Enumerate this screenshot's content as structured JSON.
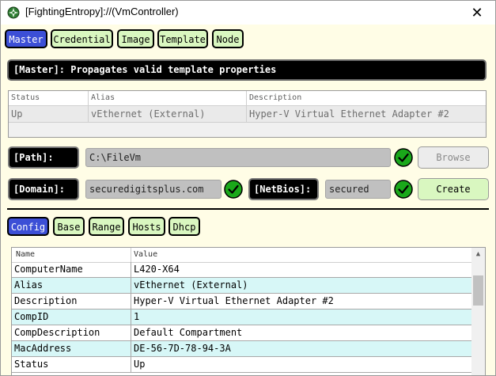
{
  "window": {
    "title": "[FightingEntropy]://(VmController)",
    "close_glyph": "✕",
    "icon": "globe-icon"
  },
  "main_tabs": [
    {
      "label": "Master",
      "active": true
    },
    {
      "label": "Credential",
      "active": false
    },
    {
      "label": "Image",
      "active": false
    },
    {
      "label": "Template",
      "active": false
    },
    {
      "label": "Node",
      "active": false
    }
  ],
  "banner": {
    "text": "[Master]: Propagates valid template properties"
  },
  "adapter_grid": {
    "columns": [
      "Status",
      "Alias",
      "Description"
    ],
    "rows": [
      [
        "Up",
        "vEthernet (External)",
        "Hyper-V Virtual Ethernet Adapter #2"
      ]
    ]
  },
  "path": {
    "label": "[Path]:",
    "value": "C:\\FileVm",
    "browse_label": "Browse"
  },
  "domain": {
    "label": "[Domain]:",
    "value": "securedigitsplus.com"
  },
  "netbios": {
    "label": "[NetBios]:",
    "value": "secured",
    "create_label": "Create"
  },
  "sub_tabs": [
    {
      "label": "Config",
      "active": true
    },
    {
      "label": "Base",
      "active": false
    },
    {
      "label": "Range",
      "active": false
    },
    {
      "label": "Hosts",
      "active": false
    },
    {
      "label": "Dhcp",
      "active": false
    }
  ],
  "properties": {
    "columns": [
      "Name",
      "Value"
    ],
    "rows": [
      [
        "ComputerName",
        "L420-X64"
      ],
      [
        "Alias",
        "vEthernet (External)"
      ],
      [
        "Description",
        "Hyper-V Virtual Ethernet Adapter #2"
      ],
      [
        "CompID",
        "1"
      ],
      [
        "CompDescription",
        "Default Compartment"
      ],
      [
        "MacAddress",
        "DE-56-7D-78-94-3A"
      ],
      [
        "Status",
        "Up"
      ]
    ]
  },
  "scrollbar": {
    "up_glyph": "▲",
    "down_glyph": "▼"
  },
  "colors": {
    "accent_blue": "#3c4fd6",
    "tab_green": "#d9f7c0",
    "check_green": "#1aa81a",
    "background": "#fffde6",
    "row_cyan": "#d7f7f7"
  }
}
